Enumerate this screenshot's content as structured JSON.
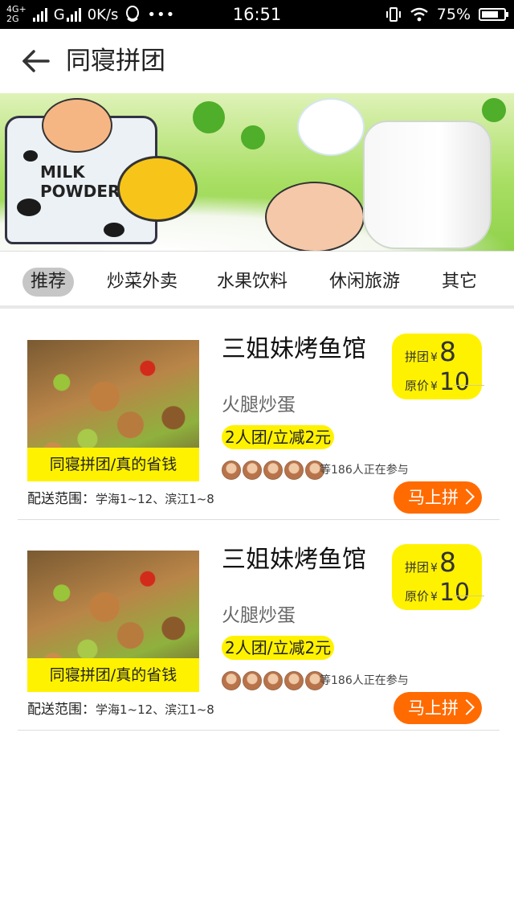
{
  "status_bar": {
    "network_top": "4G+",
    "network_bottom": "2G",
    "carrier_letter": "G",
    "speed": "0K/s",
    "time": "16:51",
    "battery": "75%",
    "battery_level": 0.75,
    "icons": [
      "signal-icon",
      "qq-icon",
      "more-icon",
      "vibrate-icon",
      "wifi-icon",
      "battery-icon"
    ]
  },
  "header": {
    "back_icon": "back-arrow-icon",
    "title": "同寝拼团"
  },
  "banner": {
    "can_text_line1": "MILK",
    "can_text_line2": "POWDER"
  },
  "tabs": [
    {
      "label": "推荐",
      "active": true
    },
    {
      "label": "炒菜外卖",
      "active": false
    },
    {
      "label": "水果饮料",
      "active": false
    },
    {
      "label": "休闲旅游",
      "active": false
    },
    {
      "label": "其它",
      "active": false
    }
  ],
  "cards": [
    {
      "image_caption": "同寝拼团/真的省钱",
      "shop_name": "三姐妹烤鱼馆",
      "dish": "火腿炒蛋",
      "promo": "2人团/立减2元",
      "participants": "等186人正在参与",
      "delivery_label": "配送范围：",
      "delivery_value": "学海1~12、滨江1~8",
      "group_price_label": "拼团",
      "group_price_currency": "¥",
      "group_price": "8",
      "orig_price_label": "原价",
      "orig_price_currency": "¥",
      "orig_price": "10",
      "button_label": "马上拼"
    },
    {
      "image_caption": "同寝拼团/真的省钱",
      "shop_name": "三姐妹烤鱼馆",
      "dish": "火腿炒蛋",
      "promo": "2人团/立减2元",
      "participants": "等186人正在参与",
      "delivery_label": "配送范围：",
      "delivery_value": "学海1~12、滨江1~8",
      "group_price_label": "拼团",
      "group_price_currency": "¥",
      "group_price": "8",
      "orig_price_label": "原价",
      "orig_price_currency": "¥",
      "orig_price": "10",
      "button_label": "马上拼"
    }
  ],
  "colors": {
    "accent_yellow": "#fff200",
    "button_orange": "#ff6b00",
    "tab_active_bg": "#c6c6c6"
  }
}
